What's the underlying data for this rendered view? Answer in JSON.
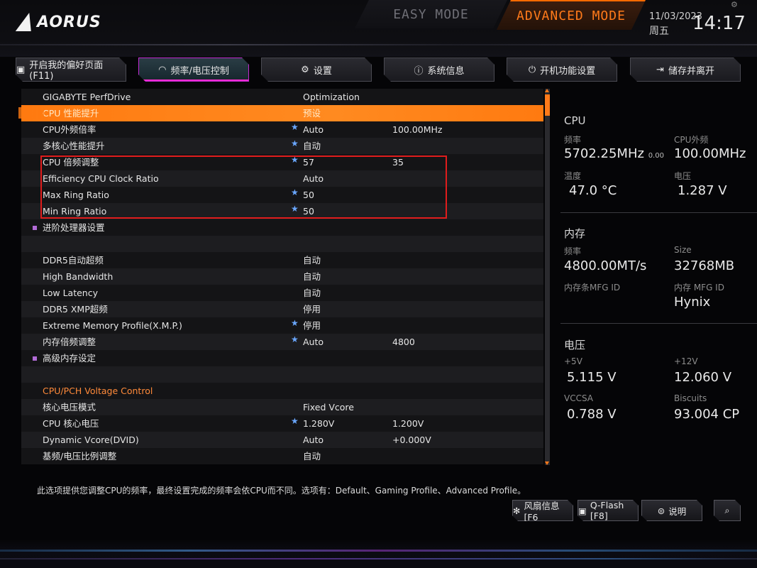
{
  "header": {
    "brand": "AORUS",
    "easy_mode": "EASY MODE",
    "advanced_mode": "ADVANCED MODE",
    "date": "11/03/2023",
    "weekday": "周五",
    "time": "14:17"
  },
  "tabs": [
    {
      "label": "开启我的偏好页面 (F11)",
      "icon": "favorite-page-icon"
    },
    {
      "label": "频率/电压控制",
      "icon": "speedometer-icon"
    },
    {
      "label": "设置",
      "icon": "gear-icon"
    },
    {
      "label": "系统信息",
      "icon": "info-icon"
    },
    {
      "label": "开机功能设置",
      "icon": "power-icon"
    },
    {
      "label": "储存并离开",
      "icon": "exit-icon"
    }
  ],
  "rows": [
    {
      "label": "GIGABYTE PerfDrive",
      "v1": "Optimization",
      "v2": "",
      "star": false,
      "kind": "normal"
    },
    {
      "label": "CPU 性能提升",
      "v1": "预设",
      "v2": "",
      "star": false,
      "kind": "selected"
    },
    {
      "label": "CPU外频倍率",
      "v1": "Auto",
      "v2": "100.00MHz",
      "star": true,
      "kind": "normal"
    },
    {
      "label": "多核心性能提升",
      "v1": "自动",
      "v2": "",
      "star": true,
      "kind": "normal"
    },
    {
      "label": "CPU 倍频调整",
      "v1": "57",
      "v2": "35",
      "star": true,
      "kind": "normal"
    },
    {
      "label": "Efficiency CPU Clock Ratio",
      "v1": "Auto",
      "v2": "",
      "star": false,
      "kind": "normal"
    },
    {
      "label": "Max Ring Ratio",
      "v1": "50",
      "v2": "",
      "star": true,
      "kind": "normal"
    },
    {
      "label": "Min Ring Ratio",
      "v1": "50",
      "v2": "",
      "star": true,
      "kind": "normal"
    },
    {
      "label": "进阶处理器设置",
      "v1": "",
      "v2": "",
      "star": false,
      "kind": "submenu"
    },
    {
      "label": "",
      "v1": "",
      "v2": "",
      "star": false,
      "kind": "blank"
    },
    {
      "label": "DDR5自动超频",
      "v1": "自动",
      "v2": "",
      "star": false,
      "kind": "normal"
    },
    {
      "label": "High Bandwidth",
      "v1": "自动",
      "v2": "",
      "star": false,
      "kind": "normal"
    },
    {
      "label": "Low Latency",
      "v1": "自动",
      "v2": "",
      "star": false,
      "kind": "normal"
    },
    {
      "label": "DDR5 XMP超频",
      "v1": "停用",
      "v2": "",
      "star": false,
      "kind": "normal"
    },
    {
      "label": "Extreme Memory Profile(X.M.P.)",
      "v1": "停用",
      "v2": "",
      "star": true,
      "kind": "normal"
    },
    {
      "label": "内存倍频调整",
      "v1": "Auto",
      "v2": "4800",
      "star": true,
      "kind": "normal"
    },
    {
      "label": "高级内存设定",
      "v1": "",
      "v2": "",
      "star": false,
      "kind": "submenu"
    },
    {
      "label": "",
      "v1": "",
      "v2": "",
      "star": false,
      "kind": "blank"
    },
    {
      "label": "CPU/PCH Voltage Control",
      "v1": "",
      "v2": "",
      "star": false,
      "kind": "section"
    },
    {
      "label": "核心电压模式",
      "v1": "Fixed Vcore",
      "v2": "",
      "star": false,
      "kind": "normal"
    },
    {
      "label": "CPU 核心电压",
      "v1": "1.280V",
      "v2": "1.200V",
      "star": true,
      "kind": "normal"
    },
    {
      "label": "Dynamic Vcore(DVID)",
      "v1": "Auto",
      "v2": "+0.000V",
      "star": false,
      "kind": "normal"
    },
    {
      "label": "基频/电压比例调整",
      "v1": "自动",
      "v2": "",
      "star": false,
      "kind": "normal"
    }
  ],
  "panel": {
    "cpu": {
      "title": "CPU",
      "freq_label": "频率",
      "freq_value": "5702.25MHz",
      "freq_sub": "0.00",
      "bclk_label": "CPU外频",
      "bclk_value": "100.00MHz",
      "temp_label": "温度",
      "temp_value": "47.0 °C",
      "volt_label": "电压",
      "volt_value": "1.287 V"
    },
    "memory": {
      "title": "内存",
      "freq_label": "频率",
      "freq_value": "4800.00MT/s",
      "size_label": "Size",
      "size_value": "32768MB",
      "mfg_label": "内存条MFG ID",
      "chip_mfg_label": "内存 MFG ID",
      "chip_mfg_value": "Hynix"
    },
    "voltage": {
      "title": "电压",
      "p5v_label": "+5V",
      "p5v_value": "5.115 V",
      "p12v_label": "+12V",
      "p12v_value": "12.060 V",
      "vccsa_label": "VCCSA",
      "vccsa_value": "0.788 V",
      "biscuits_label": "Biscuits",
      "biscuits_value": "93.004 CP"
    }
  },
  "footer": {
    "description": "此选项提供您调整CPU的频率，最终设置完成的频率会依CPU而不同。选项有：Default、Gaming Profile、Advanced Profile。",
    "fan_label": "风扇信息 [F6",
    "qflash_label": "Q-Flash [F8]",
    "help_label": "说明"
  },
  "colors": {
    "accent": "#ff7a10",
    "highlight_box": "#e01c1c",
    "star": "#6aa7ff"
  }
}
